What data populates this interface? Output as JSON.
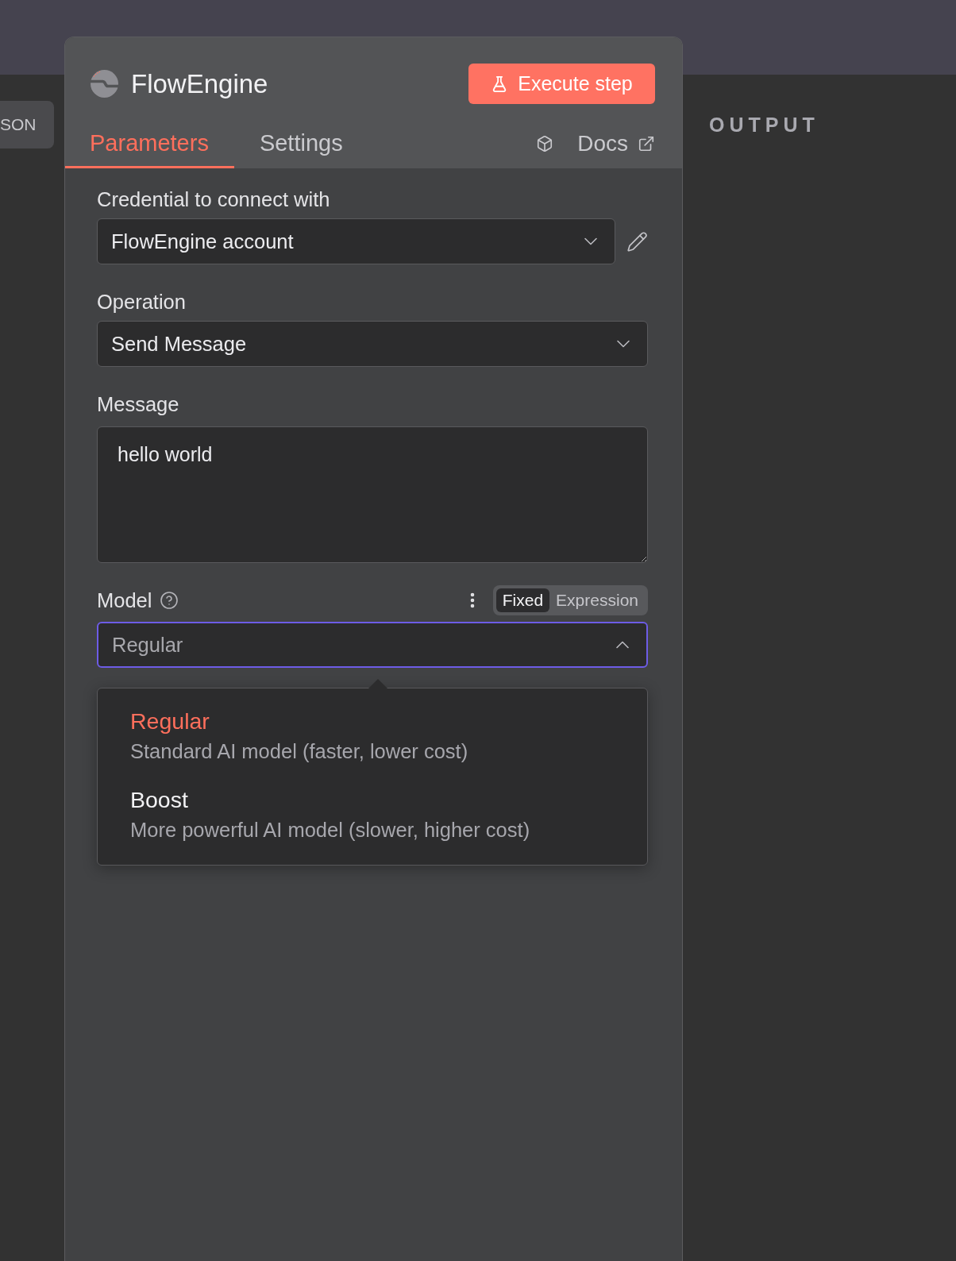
{
  "input_pane": {
    "button": "SON"
  },
  "node_panel": {
    "title": "FlowEngine",
    "execute_button": "Execute step",
    "tabs": [
      {
        "label": "Parameters",
        "selected": true
      },
      {
        "label": "Settings",
        "selected": false
      }
    ],
    "docs_link": "Docs",
    "fields": [
      {
        "kind": "select",
        "label": "Credential to connect with",
        "value": "FlowEngine account",
        "expanded": false,
        "editable": true,
        "help": false
      },
      {
        "kind": "select",
        "label": "Operation",
        "value": "Send Message",
        "expanded": false,
        "editable": false,
        "help": false
      },
      {
        "kind": "textarea",
        "label": "Message",
        "value": "hello world",
        "help": false
      },
      {
        "kind": "select",
        "label": "Model",
        "value": "Regular",
        "expanded": true,
        "editable": false,
        "help": true,
        "mode_toggle": [
          {
            "label": "Fixed",
            "selected": true
          },
          {
            "label": "Expression",
            "selected": false
          }
        ],
        "options": [
          {
            "label": "Regular",
            "description": "Standard AI model (faster, lower cost)",
            "selected": true
          },
          {
            "label": "Boost",
            "description": "More powerful AI model (slower, higher cost)",
            "selected": false
          }
        ]
      }
    ]
  },
  "output_pane": {
    "title": "OUTPUT"
  }
}
